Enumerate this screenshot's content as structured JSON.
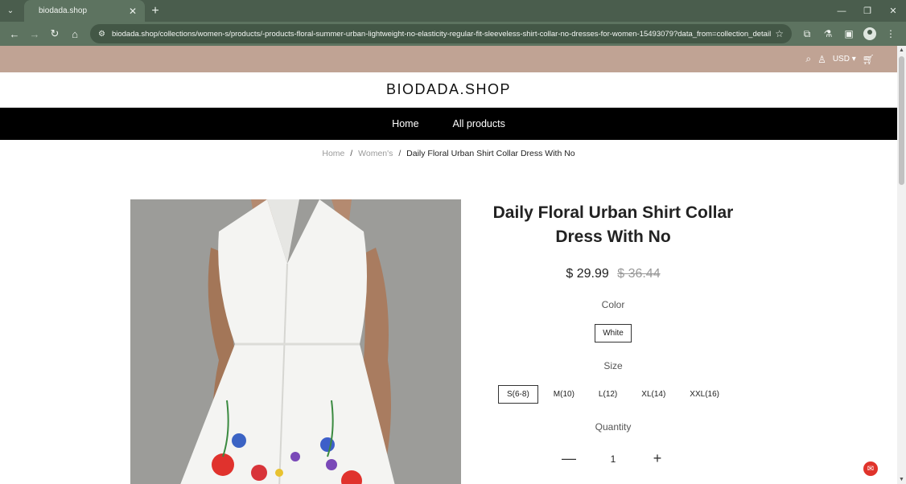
{
  "browser": {
    "tab_title": "biodada.shop",
    "url": "biodada.shop/collections/women-s/products/-products-floral-summer-urban-lightweight-no-elasticity-regular-fit-sleeveless-shirt-collar-no-dresses-for-women-15493079?data_from=collection_detail"
  },
  "topbar": {
    "currency": "USD"
  },
  "header": {
    "logo": "BIODADA.SHOP"
  },
  "nav": {
    "items": [
      {
        "label": "Home"
      },
      {
        "label": "All products"
      }
    ]
  },
  "breadcrumb": {
    "home": "Home",
    "category": "Women's",
    "current": "Daily Floral Urban Shirt Collar Dress With No",
    "separator": "/"
  },
  "product": {
    "title": "Daily Floral Urban Shirt Collar Dress With No",
    "price": "$ 29.99",
    "old_price": "$ 36.44",
    "color_label": "Color",
    "color_value": "White",
    "size_label": "Size",
    "sizes": [
      "S(6-8)",
      "M(10)",
      "L(12)",
      "XL(14)",
      "XXL(16)"
    ],
    "selected_size": "S(6-8)",
    "quantity_label": "Quantity",
    "quantity": "1"
  },
  "colors": {
    "topbar_bg": "#c0a394",
    "nav_bg": "#000000",
    "browser_frame": "#5d7360"
  }
}
